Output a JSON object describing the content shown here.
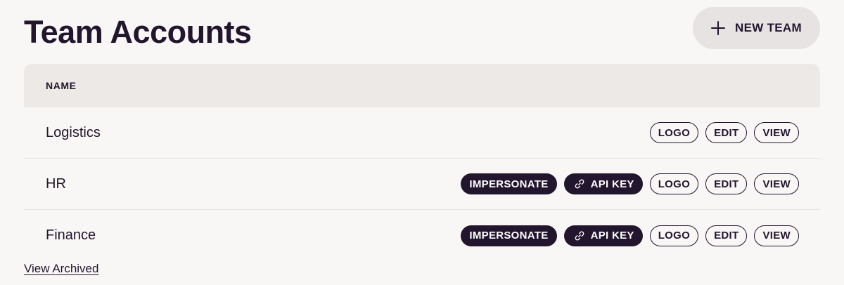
{
  "page": {
    "title": "Team Accounts",
    "new_team_label": "NEW TEAM",
    "new_team_icon": "plus-icon"
  },
  "table": {
    "columns": [
      "NAME"
    ],
    "rows": [
      {
        "name": "Logistics",
        "actions": {
          "impersonate": null,
          "api_key": null,
          "logo": "LOGO",
          "edit": "EDIT",
          "view": "VIEW"
        }
      },
      {
        "name": "HR",
        "actions": {
          "impersonate": "IMPERSONATE",
          "api_key": "API KEY",
          "logo": "LOGO",
          "edit": "EDIT",
          "view": "VIEW"
        }
      },
      {
        "name": "Finance",
        "actions": {
          "impersonate": "IMPERSONATE",
          "api_key": "API KEY",
          "logo": "LOGO",
          "edit": "EDIT",
          "view": "VIEW"
        }
      }
    ]
  },
  "footer": {
    "view_archived_label": "View Archived"
  },
  "colors": {
    "background": "#f9f7f5",
    "header_bg": "#ede9e6",
    "primary_dark": "#22152e",
    "button_gray": "#e6e3e2"
  },
  "icons": {
    "api_key_icon": "link-icon"
  }
}
